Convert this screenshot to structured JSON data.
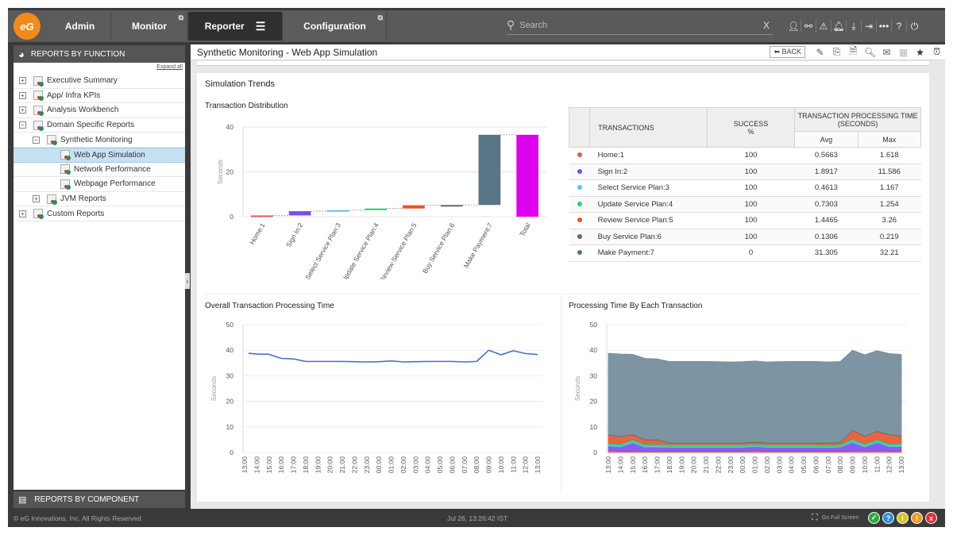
{
  "topbar": {
    "logo_text": "eG",
    "tabs": [
      {
        "label": "Admin",
        "external": false
      },
      {
        "label": "Monitor",
        "external": true
      },
      {
        "label": "Reporter",
        "active": true,
        "menu_icon": "hamburger-icon"
      },
      {
        "label": "Configuration",
        "external": true
      }
    ],
    "search": {
      "placeholder": "Search",
      "clear_label": "X"
    },
    "icons": [
      "user-icon",
      "link-icon",
      "alert-icon",
      "bell-icon",
      "download-icon",
      "signin-icon",
      "more-icon",
      "help-icon",
      "power-icon"
    ]
  },
  "sidebar": {
    "header": "REPORTS BY FUNCTION",
    "expand_all": "Expand all",
    "items": [
      {
        "label": "Executive Summary",
        "level": 0,
        "toggle": "+"
      },
      {
        "label": "App/ Infra KPIs",
        "level": 0,
        "toggle": "+"
      },
      {
        "label": "Analysis Workbench",
        "level": 0,
        "toggle": "+"
      },
      {
        "label": "Domain Specific Reports",
        "level": 0,
        "toggle": "-"
      },
      {
        "label": "Synthetic Monitoring",
        "level": 1,
        "toggle": "-"
      },
      {
        "label": "Web App Simulation",
        "level": 2,
        "selected": true
      },
      {
        "label": "Network Performance",
        "level": 2
      },
      {
        "label": "Webpage Performance",
        "level": 2
      },
      {
        "label": "JVM Reports",
        "level": 1,
        "toggle": "+"
      },
      {
        "label": "Custom Reports",
        "level": 0,
        "toggle": "+"
      }
    ],
    "footer": "REPORTS BY COMPONENT"
  },
  "main": {
    "title": "Synthetic Monitoring - Web App Simulation",
    "back_label": "BACK",
    "header_icons": [
      "edit-report-icon",
      "copy-report-icon",
      "pdf-report-icon",
      "search-report-icon",
      "email-icon",
      "excel-icon",
      "star-icon",
      "alarm-icon"
    ],
    "section_title": "Simulation Trends",
    "dist_title": "Transaction Distribution",
    "overall_title": "Overall Transaction Processing Time",
    "each_title": "Processing Time By Each Transaction"
  },
  "table": {
    "headers": {
      "transactions": "TRANSACTIONS",
      "success": "SUCCESS",
      "success_unit": "%",
      "time": "TRANSACTION PROCESSING TIME",
      "time_unit": "(SECONDS)",
      "avg": "Avg",
      "max": "Max"
    },
    "rows": [
      {
        "color": "#e05a5a",
        "name": "Home:1",
        "success": "100",
        "avg": "0.5663",
        "max": "1.618"
      },
      {
        "color": "#7b4cf0",
        "name": "Sign In:2",
        "success": "100",
        "avg": "1.8917",
        "max": "11.586"
      },
      {
        "color": "#5bc0eb",
        "name": "Select Service Plan:3",
        "success": "100",
        "avg": "0.4613",
        "max": "1.167"
      },
      {
        "color": "#2ecc71",
        "name": "Update Service Plan:4",
        "success": "100",
        "avg": "0.7303",
        "max": "1.254"
      },
      {
        "color": "#e8542a",
        "name": "Review Service Plan:5",
        "success": "100",
        "avg": "1.4465",
        "max": "3.26"
      },
      {
        "color": "#666666",
        "name": "Buy Service Plan:6",
        "success": "100",
        "avg": "0.1306",
        "max": "0.219"
      },
      {
        "color": "#5a7585",
        "name": "Make Payment:7",
        "success": "0",
        "avg": "31.305",
        "max": "32.21"
      }
    ]
  },
  "chart_data": [
    {
      "type": "bar",
      "subtype": "waterfall",
      "title": "Transaction Distribution",
      "xlabel": "",
      "ylabel": "Seconds",
      "ylim": [
        0,
        40
      ],
      "yticks": [
        0,
        20,
        40
      ],
      "categories": [
        "Home:1",
        "Sign In:2",
        "Select Service Plan:3",
        "Update Service Plan:4",
        "Review Service Plan:5",
        "Buy Service Plan:6",
        "Make Payment:7",
        "Total"
      ],
      "values": [
        0.5663,
        1.8917,
        0.4613,
        0.7303,
        1.4465,
        0.1306,
        31.305,
        36.53
      ],
      "colors": [
        "#e05a5a",
        "#7b4cf0",
        "#5bc0eb",
        "#2ecc71",
        "#e8542a",
        "#666666",
        "#5a7585",
        "#dd00ee"
      ],
      "grid": true
    },
    {
      "type": "line",
      "title": "Overall Transaction Processing Time",
      "ylabel": "Seconds",
      "ylim": [
        0,
        50
      ],
      "yticks": [
        0,
        10,
        20,
        30,
        40,
        50
      ],
      "x": [
        "13:00",
        "14:00",
        "15:00",
        "16:00",
        "17:00",
        "18:00",
        "19:00",
        "20:00",
        "21:00",
        "22:00",
        "23:00",
        "00:00",
        "01:00",
        "02:00",
        "03:00",
        "04:00",
        "05:00",
        "06:00",
        "07:00",
        "08:00",
        "09:00",
        "10:00",
        "11:00",
        "12:00",
        "13:00"
      ],
      "series": [
        {
          "name": "Overall",
          "color": "#4472c4",
          "values": [
            38.8,
            38.5,
            38.4,
            36.8,
            36.6,
            35.6,
            35.6,
            35.6,
            35.6,
            35.5,
            35.4,
            35.5,
            35.8,
            35.4,
            35.5,
            35.6,
            35.6,
            35.6,
            35.4,
            35.6,
            40.0,
            38.2,
            39.8,
            38.7,
            38.3
          ]
        }
      ],
      "grid": true
    },
    {
      "type": "area",
      "stacked": true,
      "title": "Processing Time By Each Transaction",
      "ylabel": "Seconds",
      "ylim": [
        0,
        50
      ],
      "yticks": [
        0,
        10,
        20,
        30,
        40,
        50
      ],
      "x": [
        "13:00",
        "14:00",
        "15:00",
        "16:00",
        "17:00",
        "18:00",
        "19:00",
        "20:00",
        "21:00",
        "22:00",
        "23:00",
        "00:00",
        "01:00",
        "02:00",
        "03:00",
        "04:00",
        "05:00",
        "06:00",
        "07:00",
        "08:00",
        "09:00",
        "10:00",
        "11:00",
        "12:00",
        "13:00"
      ],
      "series": [
        {
          "name": "Home:1",
          "color": "#e05a5a",
          "values": [
            0.9,
            0.6,
            0.6,
            0.5,
            0.5,
            0.5,
            0.5,
            0.5,
            0.5,
            0.5,
            0.5,
            0.5,
            0.7,
            0.5,
            0.5,
            0.5,
            0.5,
            0.5,
            0.4,
            0.5,
            0.7,
            0.6,
            0.7,
            0.6,
            0.6
          ]
        },
        {
          "name": "Sign In:2",
          "color": "#7b4cf0",
          "values": [
            1.6,
            1.6,
            3.2,
            1.6,
            1.6,
            1.5,
            1.5,
            1.5,
            1.5,
            1.5,
            1.5,
            1.5,
            1.6,
            1.5,
            1.5,
            1.5,
            1.5,
            1.5,
            1.5,
            1.6,
            3.3,
            1.6,
            3.2,
            1.7,
            1.7
          ]
        },
        {
          "name": "Select Service Plan:3",
          "color": "#5bc0eb",
          "values": [
            0.5,
            0.5,
            0.5,
            0.5,
            0.5,
            0.4,
            0.4,
            0.4,
            0.4,
            0.4,
            0.4,
            0.4,
            0.4,
            0.4,
            0.4,
            0.4,
            0.4,
            0.4,
            0.4,
            0.4,
            0.5,
            0.5,
            0.5,
            0.5,
            0.5
          ]
        },
        {
          "name": "Update Service Plan:4",
          "color": "#2ecc71",
          "values": [
            0.7,
            0.7,
            0.8,
            0.7,
            0.7,
            0.7,
            0.7,
            0.7,
            0.7,
            0.7,
            0.7,
            0.7,
            0.7,
            0.7,
            0.7,
            0.7,
            0.7,
            0.7,
            0.7,
            0.7,
            0.8,
            0.7,
            0.8,
            0.7,
            0.7
          ]
        },
        {
          "name": "Review Service Plan:5",
          "color": "#e8542a",
          "values": [
            3.0,
            2.8,
            1.8,
            1.6,
            1.6,
            0.6,
            0.6,
            0.6,
            0.6,
            0.6,
            0.6,
            0.6,
            0.6,
            0.6,
            0.6,
            0.6,
            0.6,
            0.6,
            0.6,
            0.6,
            3.3,
            2.9,
            3.0,
            3.4,
            2.8
          ]
        },
        {
          "name": "Buy Service Plan:6",
          "color": "#666666",
          "values": [
            0.2,
            0.2,
            0.2,
            0.2,
            0.2,
            0.2,
            0.2,
            0.2,
            0.2,
            0.2,
            0.2,
            0.2,
            0.2,
            0.2,
            0.2,
            0.2,
            0.2,
            0.2,
            0.2,
            0.2,
            0.2,
            0.2,
            0.2,
            0.2,
            0.2
          ]
        },
        {
          "name": "Make Payment:7",
          "color": "#6f8a98",
          "values": [
            31.9,
            32.1,
            31.3,
            31.7,
            31.5,
            31.7,
            31.7,
            31.7,
            31.7,
            31.6,
            31.5,
            31.6,
            31.6,
            31.5,
            31.6,
            31.7,
            31.7,
            31.7,
            31.6,
            31.6,
            31.2,
            31.7,
            31.4,
            31.6,
            31.8
          ]
        }
      ],
      "grid": true
    }
  ],
  "footer": {
    "copyright": "© eG Innovations, Inc. All Rights Reserved",
    "clock": "Jul 26, 13:26:42 IST",
    "fullscreen_label": "Go Full Screen",
    "status_icons": [
      {
        "name": "status-ok-icon",
        "glyph": "✓",
        "color": "#2eaa3a"
      },
      {
        "name": "status-unknown-icon",
        "glyph": "?",
        "color": "#2b8fd6"
      },
      {
        "name": "status-info-icon",
        "glyph": "i",
        "color": "#d8c51c"
      },
      {
        "name": "status-warning-icon",
        "glyph": "!",
        "color": "#f39a1c"
      },
      {
        "name": "status-critical-icon",
        "glyph": "x",
        "color": "#e0303a"
      }
    ]
  }
}
